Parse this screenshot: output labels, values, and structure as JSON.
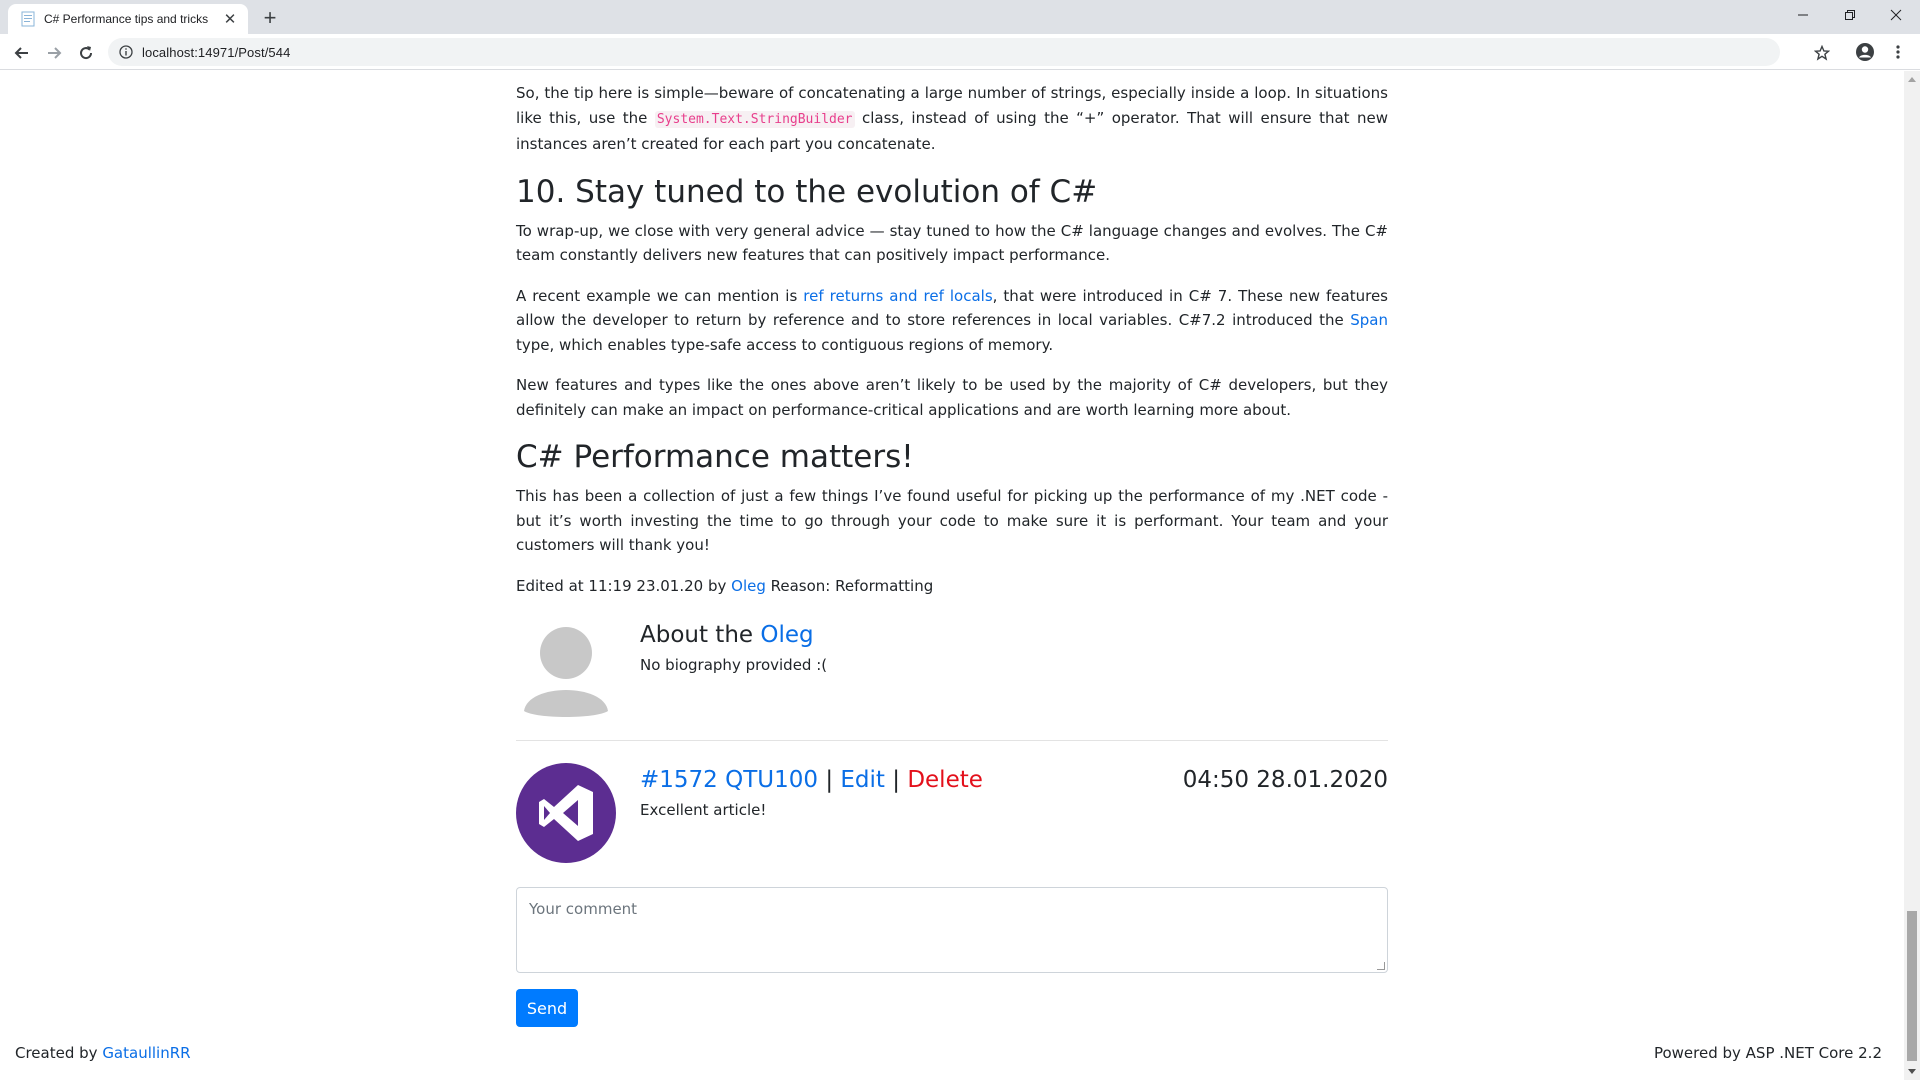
{
  "browser": {
    "tab_title": "C# Performance tips and tricks",
    "url": "localhost:14971/Post/544"
  },
  "article": {
    "p1_a": "So, the tip here is simple—beware of concatenating a large number of strings, especially inside a loop. In situations like this, use the ",
    "p1_code": "System.Text.StringBuilder",
    "p1_b": " class, instead of using the “+” operator. That will ensure that new instances aren’t created for each part you concatenate.",
    "h_evolution": "10. Stay tuned to the evolution of C#",
    "p2": "To wrap-up, we close with very general advice — stay tuned to how the C# language changes and evolves. The C# team constantly delivers new features that can positively impact performance.",
    "p3_a": "A recent example we can mention is ",
    "p3_link1": "ref returns and ref locals",
    "p3_b": ", that were introduced in C# 7. These new features allow the developer to return by reference and to store references in local variables. C#7.2 introduced the ",
    "p3_link2": "Span",
    "p3_c": " type, which enables type-safe access to contiguous regions of memory.",
    "p4": "New features and types like the ones above aren’t likely to be used by the majority of C# developers, but they definitely can make an impact on performance-critical applications and are worth learning more about.",
    "h_matters": "C# Performance matters!",
    "p5": "This has been a collection of just a few things I’ve found useful for picking up the performance of my .NET code - but it’s worth investing the time to go through your code to make sure it is performant. Your team and your customers will thank you!",
    "edited_prefix": "Edited at 11:19 23.01.20 by ",
    "edited_author": "Oleg",
    "edited_suffix": " Reason: Reformatting"
  },
  "author_box": {
    "about_prefix": "About the ",
    "name": "Oleg",
    "bio": "No biography provided :("
  },
  "comment": {
    "id_user": "#1572 QTU100",
    "sep": "|",
    "edit": "Edit",
    "delete": "Delete",
    "timestamp": "04:50 28.01.2020",
    "text": "Excellent article!"
  },
  "comment_form": {
    "placeholder": "Your comment",
    "send": "Send"
  },
  "footer": {
    "created_prefix": "Created by ",
    "created_link": "GataullinRR",
    "powered": "Powered by ASP .NET Core 2.2"
  },
  "colors": {
    "link": "#0a6ee6",
    "danger": "#e3101b",
    "primary": "#007bff",
    "vs_purple": "#5c2d91"
  }
}
